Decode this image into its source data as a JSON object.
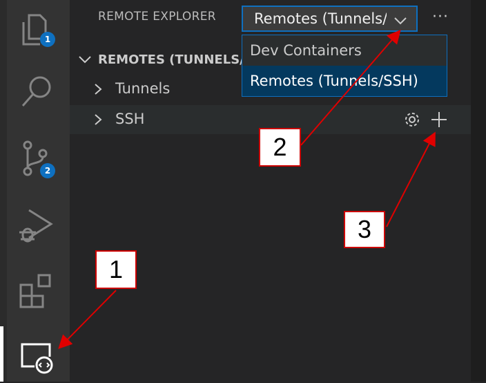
{
  "activity_bar": {
    "items": [
      {
        "icon": "files-icon",
        "badge": "1"
      },
      {
        "icon": "search-icon"
      },
      {
        "icon": "source-control-icon",
        "badge": "2"
      },
      {
        "icon": "run-debug-icon"
      },
      {
        "icon": "extensions-icon"
      },
      {
        "icon": "remote-explorer-icon",
        "active": true
      }
    ]
  },
  "sidebar": {
    "title": "REMOTE EXPLORER",
    "selector_value": "Remotes (Tunnels/SSH)",
    "more_label": "···",
    "dropdown_options": [
      "Dev Containers",
      "Remotes (Tunnels/SSH)"
    ],
    "section_header": "REMOTES (TUNNELS/SSH)",
    "tree": [
      {
        "label": "Tunnels"
      },
      {
        "label": "SSH",
        "actions": [
          "gear-icon",
          "plus-icon"
        ]
      }
    ]
  },
  "callouts": [
    "1",
    "2",
    "3"
  ],
  "colors": {
    "accent": "#0e70c0",
    "annotation": "#e00000",
    "badge": "#0e70c0"
  }
}
